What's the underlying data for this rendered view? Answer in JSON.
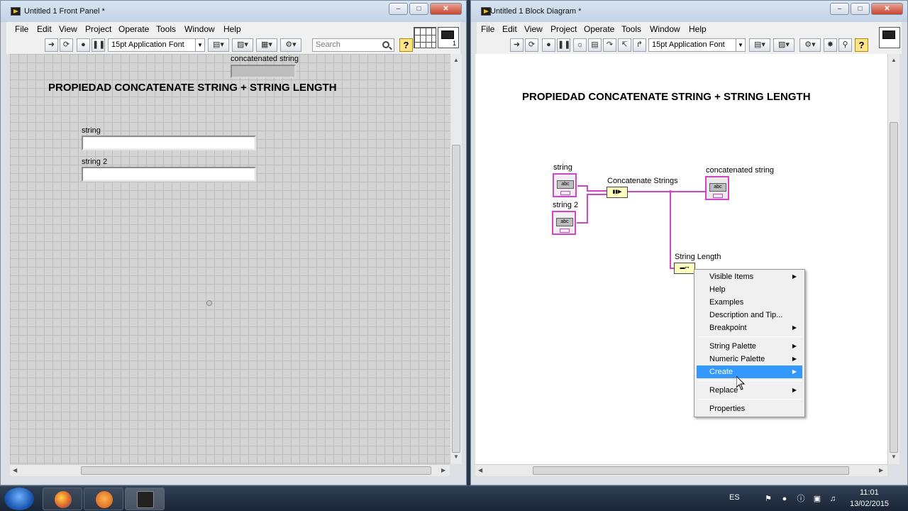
{
  "front_panel": {
    "title": "Untitled 1 Front Panel *",
    "menu": [
      "File",
      "Edit",
      "View",
      "Project",
      "Operate",
      "Tools",
      "Window",
      "Help"
    ],
    "toolbar": {
      "font": "15pt Application Font",
      "search_placeholder": "Search"
    },
    "vi_icon_number": "1",
    "heading": "PROPIEDAD CONCATENATE STRING + STRING LENGTH",
    "indicator_label": "concatenated string",
    "controls": [
      {
        "label": "string",
        "value": ""
      },
      {
        "label": "string 2",
        "value": ""
      }
    ]
  },
  "block_diagram": {
    "title": "Untitled 1 Block Diagram *",
    "menu": [
      "File",
      "Edit",
      "View",
      "Project",
      "Operate",
      "Tools",
      "Window",
      "Help"
    ],
    "toolbar": {
      "font": "15pt Application Font"
    },
    "heading": "PROPIEDAD CONCATENATE STRING + STRING LENGTH",
    "terminals": {
      "string": "string",
      "string2": "string 2",
      "concat_out": "concatenated string",
      "abc": "abc"
    },
    "nodes": {
      "concat": "Concatenate Strings",
      "length": "String Length"
    }
  },
  "context_menu": {
    "items": [
      {
        "label": "Visible Items",
        "submenu": true
      },
      {
        "label": "Help",
        "submenu": false
      },
      {
        "label": "Examples",
        "submenu": false
      },
      {
        "label": "Description and Tip...",
        "submenu": false
      },
      {
        "label": "Breakpoint",
        "submenu": true
      },
      {
        "label": "String Palette",
        "submenu": true
      },
      {
        "label": "Numeric Palette",
        "submenu": true
      },
      {
        "label": "Create",
        "submenu": true,
        "highlighted": true
      },
      {
        "label": "Replace",
        "submenu": true
      },
      {
        "label": "Properties",
        "submenu": false
      }
    ]
  },
  "taskbar": {
    "language": "ES",
    "time": "11:01",
    "date": "13/02/2015",
    "apps": [
      "firefox-icon",
      "labview-getting-started-icon",
      "labview-vi-icon"
    ]
  },
  "colors": {
    "string_wire": "#d146c8",
    "menu_highlight": "#3399ff",
    "panel_grid": "#d4d4d4"
  }
}
